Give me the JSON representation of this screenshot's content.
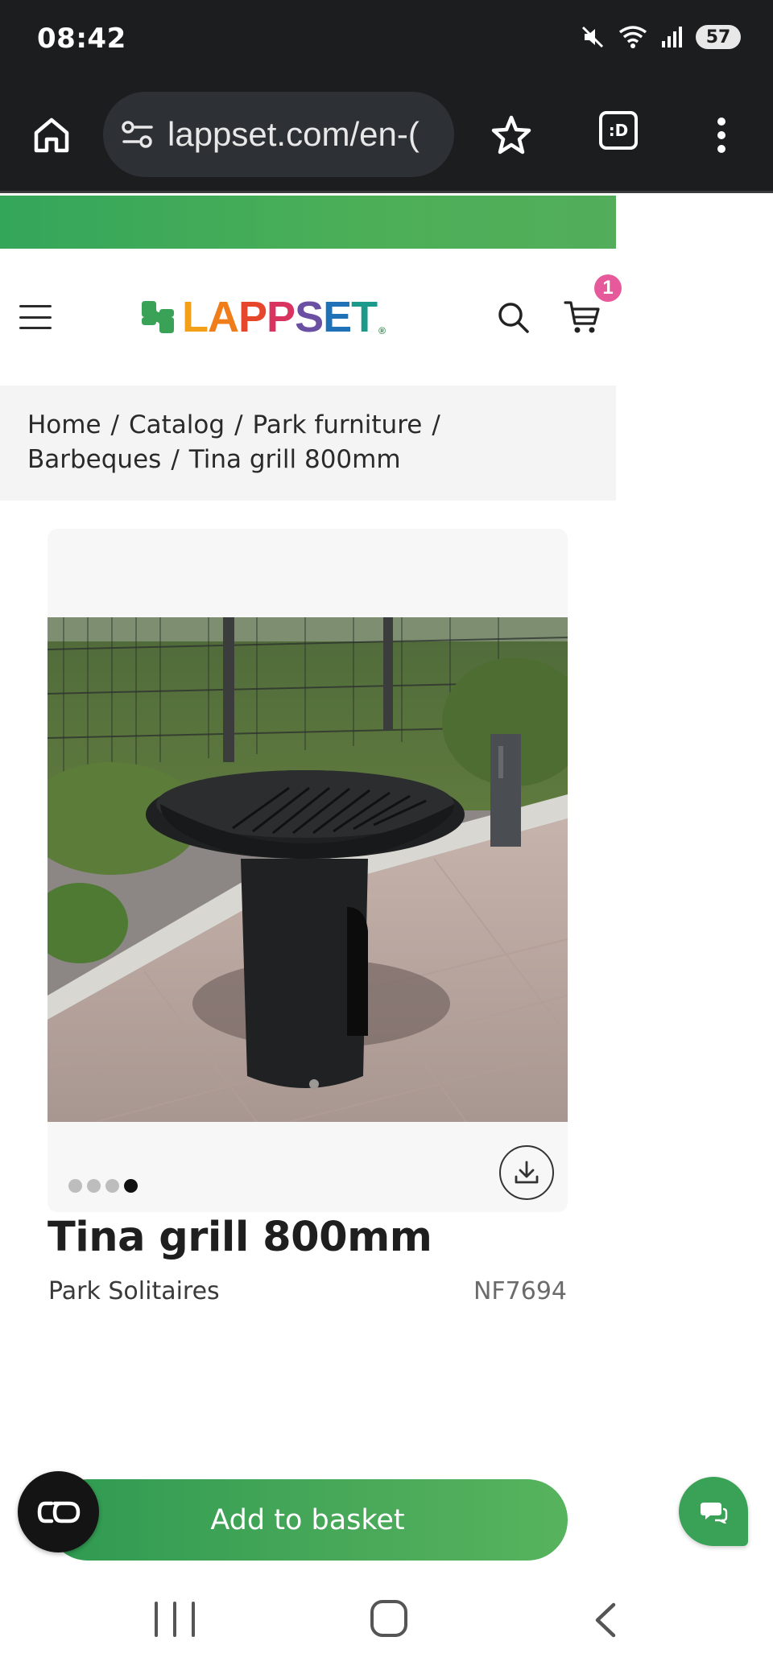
{
  "status_bar": {
    "time": "08:42",
    "battery": "57",
    "icons": [
      "mute-icon",
      "wifi-icon",
      "signal-icon",
      "battery-icon"
    ]
  },
  "browser": {
    "url": "lappset.com/en-(",
    "tab_count": ":D",
    "icons": [
      "home-icon",
      "site-settings-icon",
      "bookmark-star-icon",
      "tab-switcher-icon",
      "overflow-menu-icon"
    ]
  },
  "header": {
    "logo_text": "LAPPSET",
    "cart_count": "1",
    "icons": [
      "menu-icon",
      "search-icon",
      "cart-icon"
    ]
  },
  "breadcrumb": {
    "items": [
      "Home",
      "Catalog",
      "Park furniture",
      "Barbeques",
      "Tina grill 800mm"
    ],
    "separator": "/"
  },
  "gallery": {
    "image_count": 4,
    "active_index": 3,
    "icons": [
      "download-icon"
    ]
  },
  "product": {
    "title": "Tina grill 800mm",
    "family": "Park Solitaires",
    "code": "NF7694"
  },
  "actions": {
    "add_to_basket": "Add to basket",
    "icons": [
      "accessibility-icon",
      "chat-icon"
    ]
  },
  "colors": {
    "brand_green": "#3aa257",
    "badge_pink": "#e65a9b",
    "chrome_dark": "#1c1d1f"
  }
}
